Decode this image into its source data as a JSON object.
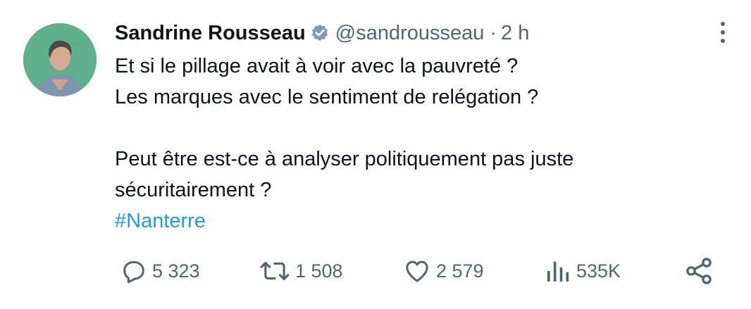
{
  "tweet": {
    "author": {
      "name": "Sandrine Rousseau",
      "handle": "@sandrousseau",
      "verified": true
    },
    "time": "2 h",
    "separator": "·",
    "lines": [
      "Et si le pillage avait à voir avec la pauvreté ?",
      "Les marques avec le sentiment de relégation ?",
      "",
      "Peut être est-ce à analyser politiquement pas juste",
      "sécuritairement ?"
    ],
    "hashtag": "#Nanterre"
  },
  "actions": {
    "replies": "5 323",
    "retweets": "1 508",
    "likes": "2 579",
    "views": "535K"
  },
  "colors": {
    "text": "#0f1419",
    "secondary": "#536471",
    "link": "#1d9bf0",
    "avatar_bg": "#5fb08f"
  },
  "icons": [
    "more-vertical-icon",
    "verified-badge-icon",
    "reply-icon",
    "retweet-icon",
    "like-icon",
    "views-icon",
    "share-icon"
  ]
}
